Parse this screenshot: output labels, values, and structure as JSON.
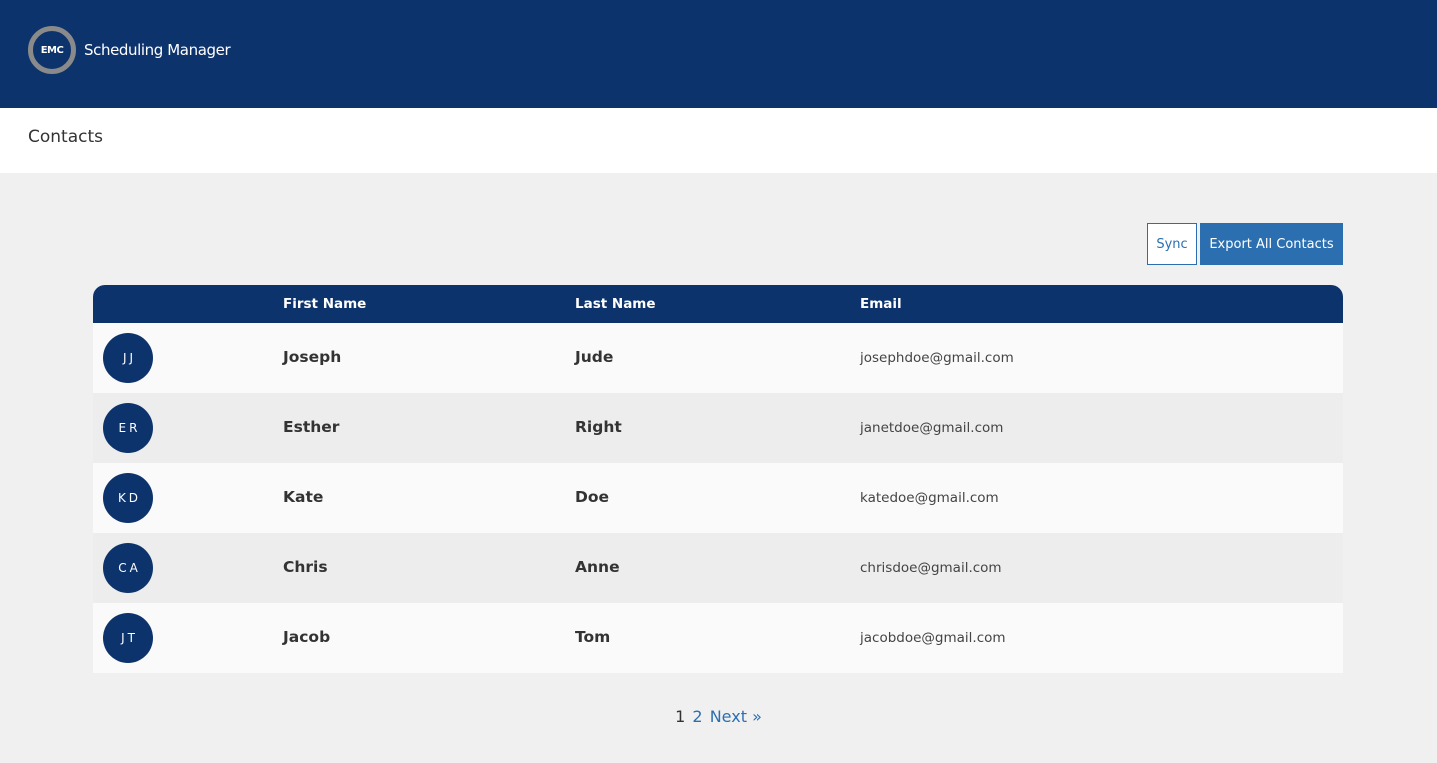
{
  "header": {
    "logo_initials": "EMC",
    "app_name": "Scheduling Manager"
  },
  "page": {
    "title": "Contacts"
  },
  "toolbar": {
    "sync_label": "Sync",
    "export_label": "Export All Contacts"
  },
  "table": {
    "columns": [
      "",
      "First Name",
      "Last Name",
      "Email"
    ],
    "rows": [
      {
        "initials": "JJ",
        "first": "Joseph",
        "last": "Jude",
        "email": "josephdoe@gmail.com"
      },
      {
        "initials": "ER",
        "first": "Esther",
        "last": "Right",
        "email": "janetdoe@gmail.com"
      },
      {
        "initials": "KD",
        "first": "Kate",
        "last": "Doe",
        "email": "katedoe@gmail.com"
      },
      {
        "initials": "CA",
        "first": "Chris",
        "last": "Anne",
        "email": "chrisdoe@gmail.com"
      },
      {
        "initials": "JT",
        "first": "Jacob",
        "last": "Tom",
        "email": "jacobdoe@gmail.com"
      }
    ]
  },
  "pagination": {
    "current": "1",
    "pages": [
      "2"
    ],
    "next_label": "Next »"
  },
  "colors": {
    "primary": "#0d336d",
    "accent": "#2c6fb0"
  }
}
